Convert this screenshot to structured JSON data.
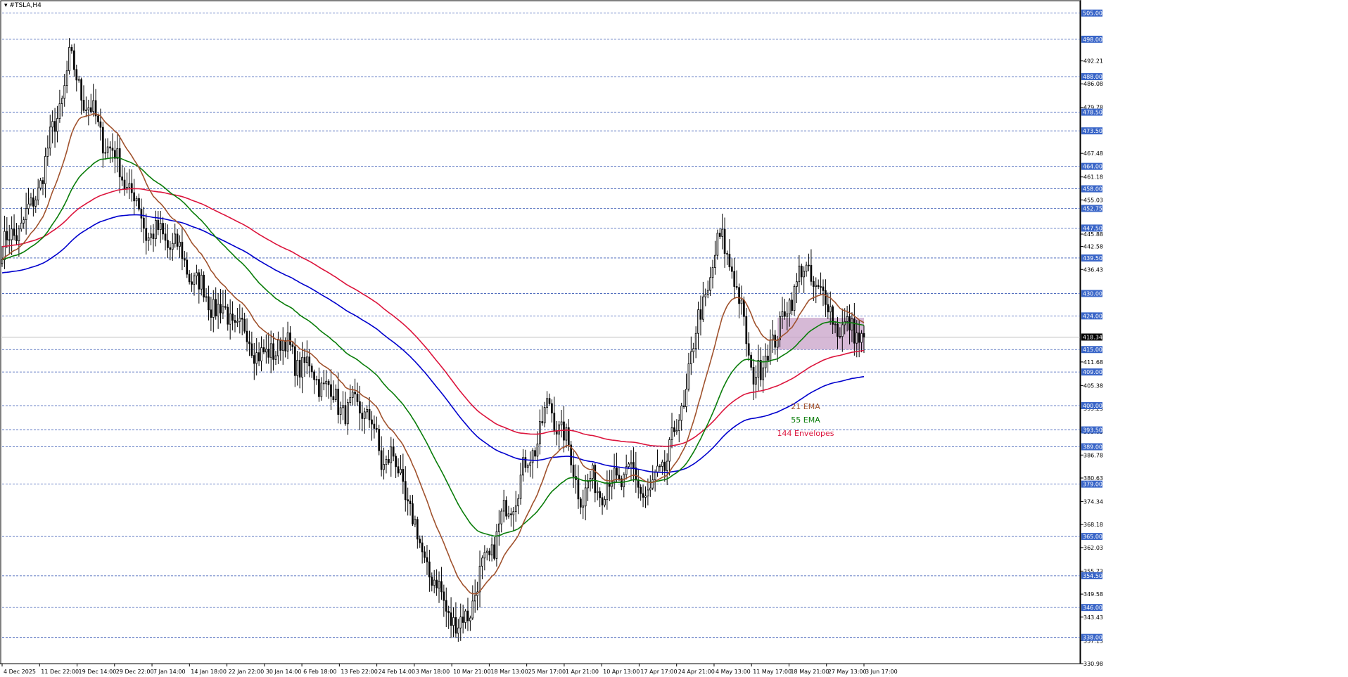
{
  "window": {
    "title": "#TSLA,H4"
  },
  "colors": {
    "background": "#ffffff",
    "grid": "#000000",
    "level_line": "#3b5bb5",
    "level_box": "#3a66c8",
    "candle": "#000000",
    "ema21": "#a0522d",
    "ema55": "#0a7d0a",
    "env_upper": "#dc143c",
    "env_lower": "#0000cd",
    "zone_fill": "#c8a2c8",
    "current_price_box": "#000000"
  },
  "chart_data": {
    "type": "candlestick",
    "symbol": "#TSLA",
    "timeframe": "H4",
    "ylim": [
      330.98,
      507.0
    ],
    "price_axis_ticks": [
      "492.21",
      "486.08",
      "479.78",
      "467.48",
      "461.18",
      "455.03",
      "445.88",
      "442.58",
      "436.43",
      "411.68",
      "405.38",
      "399.23",
      "393.03",
      "386.78",
      "380.63",
      "374.34",
      "368.18",
      "362.03",
      "355.73",
      "349.58",
      "343.43",
      "337.13",
      "330.98"
    ],
    "levels": [
      505.0,
      498.0,
      488.0,
      478.5,
      473.5,
      464.0,
      458.0,
      452.75,
      447.5,
      439.5,
      430.0,
      424.0,
      415.0,
      409.0,
      400.0,
      393.5,
      389.0,
      379.0,
      365.0,
      354.5,
      346.0,
      338.0
    ],
    "level_labels": [
      "505.00",
      "498.00",
      "488.00",
      "478.50",
      "473.50",
      "464.00",
      "458.00",
      "452.75",
      "447.50",
      "439.50",
      "430.00",
      "424.00",
      "415.00",
      "409.00",
      "400.00",
      "393.50",
      "389.00",
      "379.00",
      "365.00",
      "354.50",
      "346.00",
      "338.00"
    ],
    "current_price": 418.34,
    "current_price_label": "418.34",
    "x_ticks": [
      "4 Dec 2025",
      "11 Dec 22:00",
      "19 Dec 14:00",
      "29 Dec 22:00",
      "7 Jan 14:00",
      "14 Jan 18:00",
      "22 Jan 22:00",
      "30 Jan 14:00",
      "6 Feb 18:00",
      "13 Feb 22:00",
      "24 Feb 14:00",
      "3 Mar 18:00",
      "10 Mar 21:00",
      "18 Mar 13:00",
      "25 Mar 17:00",
      "1 Apr 21:00",
      "10 Apr 13:00",
      "17 Apr 17:00",
      "24 Apr 21:00",
      "4 May 13:00",
      "11 May 17:00",
      "18 May 21:00",
      "27 May 13:00",
      "3 Jun 17:00"
    ],
    "close_path": [
      [
        0,
        442
      ],
      [
        5,
        446
      ],
      [
        12,
        452
      ],
      [
        20,
        470
      ],
      [
        24,
        480
      ],
      [
        28,
        492
      ],
      [
        32,
        486
      ],
      [
        36,
        480
      ],
      [
        40,
        474
      ],
      [
        44,
        470
      ],
      [
        50,
        462
      ],
      [
        56,
        454
      ],
      [
        60,
        447
      ],
      [
        66,
        445
      ],
      [
        72,
        443
      ],
      [
        76,
        438
      ],
      [
        84,
        430
      ],
      [
        90,
        426
      ],
      [
        100,
        420
      ],
      [
        104,
        417
      ],
      [
        110,
        412
      ],
      [
        116,
        418
      ],
      [
        122,
        412
      ],
      [
        128,
        410
      ],
      [
        136,
        404
      ],
      [
        144,
        398
      ],
      [
        150,
        400
      ],
      [
        154,
        395
      ],
      [
        158,
        385
      ],
      [
        162,
        387
      ],
      [
        166,
        380
      ],
      [
        170,
        372
      ],
      [
        174,
        362
      ],
      [
        178,
        356
      ],
      [
        182,
        350
      ],
      [
        186,
        345
      ],
      [
        190,
        340
      ],
      [
        194,
        345
      ],
      [
        198,
        352
      ],
      [
        204,
        362
      ],
      [
        210,
        372
      ],
      [
        216,
        380
      ],
      [
        222,
        390
      ],
      [
        228,
        400
      ],
      [
        234,
        392
      ],
      [
        238,
        383
      ],
      [
        242,
        375
      ],
      [
        246,
        380
      ],
      [
        250,
        378
      ],
      [
        256,
        380
      ],
      [
        262,
        382
      ],
      [
        266,
        378
      ],
      [
        270,
        376
      ],
      [
        276,
        385
      ],
      [
        280,
        392
      ],
      [
        284,
        400
      ],
      [
        286,
        410
      ],
      [
        290,
        422
      ],
      [
        294,
        432
      ],
      [
        298,
        442
      ],
      [
        300,
        444
      ],
      [
        304,
        438
      ],
      [
        306,
        430
      ],
      [
        310,
        418
      ],
      [
        312,
        410
      ],
      [
        316,
        408
      ],
      [
        320,
        418
      ],
      [
        324,
        420
      ],
      [
        328,
        428
      ],
      [
        332,
        436
      ],
      [
        336,
        434
      ],
      [
        340,
        432
      ],
      [
        344,
        426
      ],
      [
        348,
        422
      ],
      [
        352,
        420
      ],
      [
        356,
        420
      ],
      [
        359,
        418.34
      ]
    ],
    "n_bars": 360,
    "series": [
      {
        "name": "21 EMA",
        "period": 21
      },
      {
        "name": "55 EMA",
        "period": 55
      },
      {
        "name": "144 Envelopes",
        "period": 144,
        "upper_offset": 3.5,
        "lower_offset": -3.5
      }
    ],
    "legend": [
      "21 EMA",
      "55 EMA",
      "144 Envelopes"
    ],
    "zone": {
      "x_from": 323,
      "x_to": 359,
      "y_from": 415.0,
      "y_to": 423.5
    }
  }
}
